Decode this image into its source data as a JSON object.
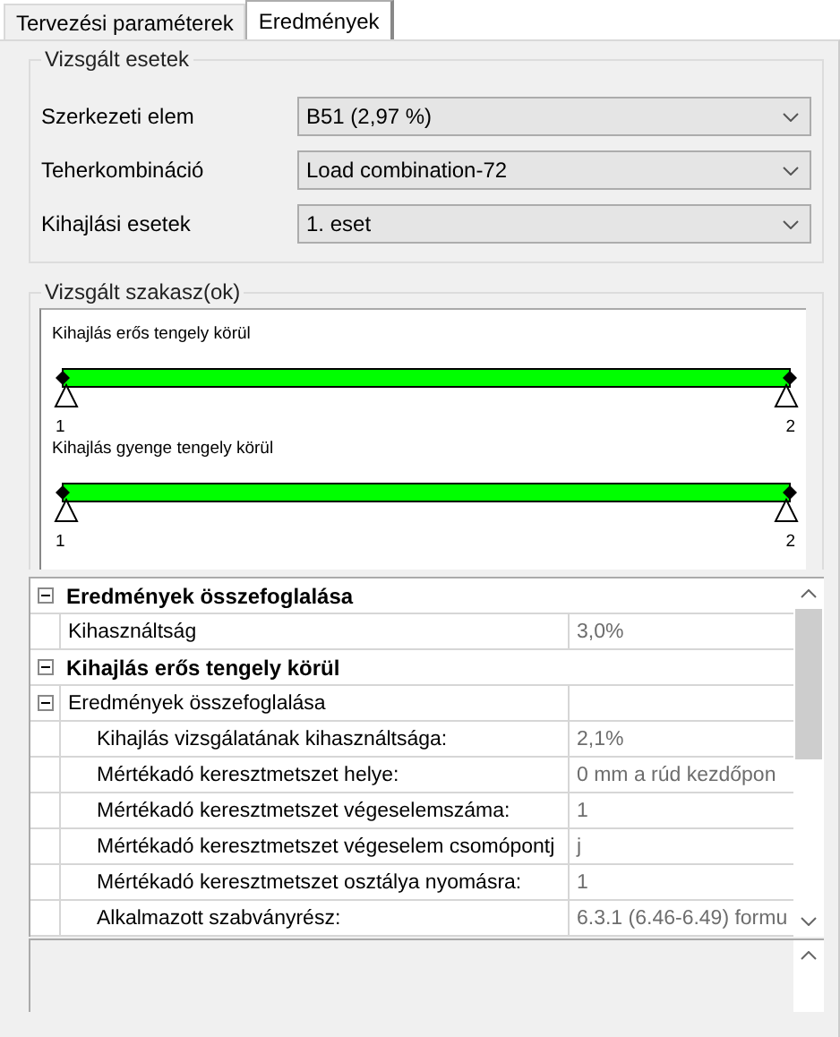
{
  "tabs": [
    {
      "label": "Tervezési paraméterek",
      "selected": false
    },
    {
      "label": "Eredmények",
      "selected": true
    }
  ],
  "cases_group": {
    "title": "Vizsgált esetek",
    "rows": [
      {
        "label": "Szerkezeti elem",
        "value": "B51 (2,97 %)"
      },
      {
        "label": "Teherkombináció",
        "value": "Load combination-72"
      },
      {
        "label": "Kihajlási esetek",
        "value": "1. eset"
      }
    ]
  },
  "sections_group": {
    "title": "Vizsgált szakasz(ok)",
    "diagrams": [
      {
        "title": "Kihajlás erős tengely körül",
        "start_label": "1",
        "end_label": "2"
      },
      {
        "title": "Kihajlás gyenge tengely körül",
        "start_label": "1",
        "end_label": "2"
      }
    ]
  },
  "property_grid": {
    "items": [
      {
        "kind": "category",
        "name": "Eredmények összefoglalása",
        "expanded": true,
        "children": [
          {
            "kind": "property",
            "name": "Kihasználtság",
            "value": "3,0%"
          }
        ]
      },
      {
        "kind": "category",
        "name": "Kihajlás erős tengely körül",
        "expanded": true,
        "children": [
          {
            "kind": "subcategory",
            "name": "Eredmények összefoglalása",
            "expanded": true,
            "children": [
              {
                "kind": "property",
                "name": "Kihajlás vizsgálatának kihasználtsága:",
                "value": "2,1%"
              },
              {
                "kind": "property",
                "name": "Mértékadó keresztmetszet helye:",
                "value": "0 mm a rúd kezdőpon"
              },
              {
                "kind": "property",
                "name": "Mértékadó keresztmetszet végeselemszáma:",
                "value": "1"
              },
              {
                "kind": "property",
                "name": "Mértékadó keresztmetszet végeselem csomópontj",
                "value": "j"
              },
              {
                "kind": "property",
                "name": "Mértékadó keresztmetszet osztálya nyomásra:",
                "value": "1"
              },
              {
                "kind": "property",
                "name": "Alkalmazott szabványrész:",
                "value": "6.3.1 (6.46-6.49) formu"
              }
            ]
          }
        ]
      }
    ]
  }
}
